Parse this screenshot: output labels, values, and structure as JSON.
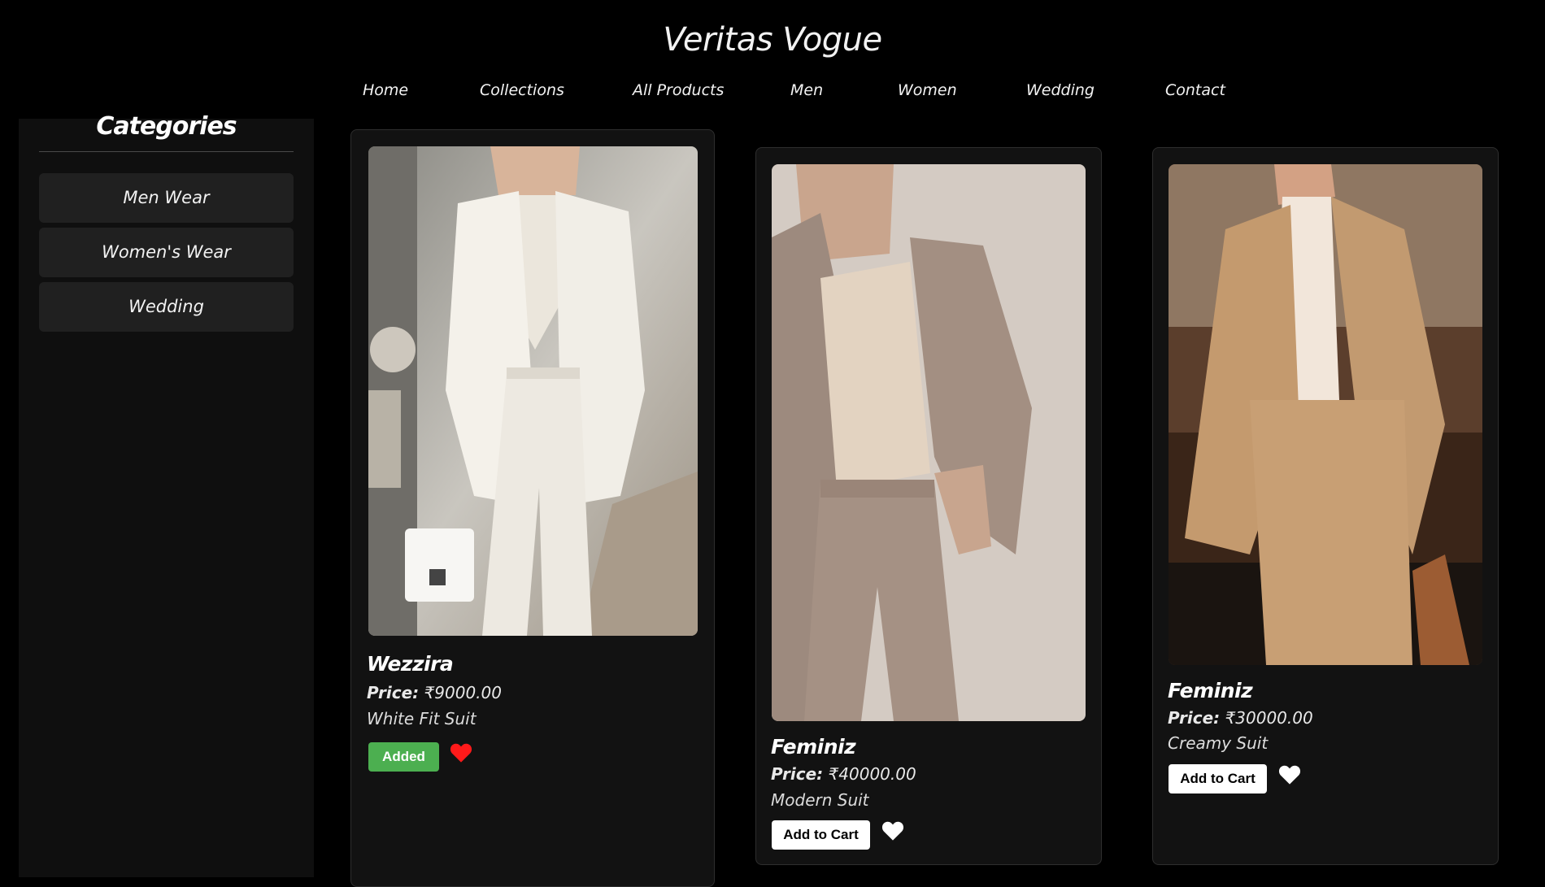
{
  "brand": {
    "title": "Veritas Vogue"
  },
  "nav": {
    "items": [
      "Home",
      "Collections",
      "All Products",
      "Men",
      "Women",
      "Wedding",
      "Contact"
    ]
  },
  "sidebar": {
    "title": "Categories",
    "items": [
      "Men Wear",
      "Women's Wear",
      "Wedding"
    ]
  },
  "products": [
    {
      "name": "Wezzira",
      "price_label": "Price:",
      "price": "₹9000.00",
      "description": "White Fit Suit",
      "button_label": "Added",
      "button_state": "added",
      "favorited": true
    },
    {
      "name": "Feminiz",
      "price_label": "Price:",
      "price": "₹40000.00",
      "description": "Modern Suit",
      "button_label": "Add to Cart",
      "button_state": "default",
      "favorited": false
    },
    {
      "name": "Feminiz",
      "price_label": "Price:",
      "price": "₹30000.00",
      "description": "Creamy Suit",
      "button_label": "Add to Cart",
      "button_state": "default",
      "favorited": false
    }
  ],
  "colors": {
    "background": "#000000",
    "sidebar": "#0f0f0f",
    "card": "#121212",
    "category_button": "#202020",
    "added_button": "#4caf50",
    "favorite_active": "#ff1a1a",
    "favorite_inactive": "#ffffff"
  },
  "icons": {
    "favorite": "heart-icon"
  }
}
